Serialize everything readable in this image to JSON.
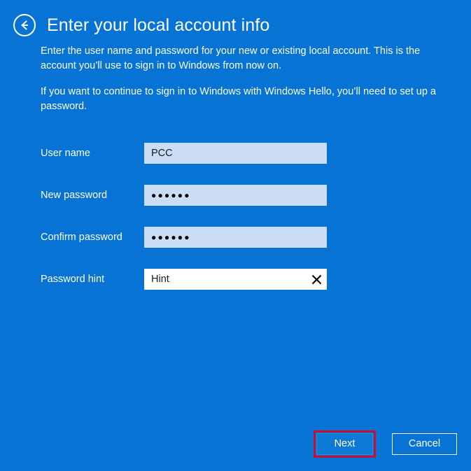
{
  "window": {
    "background_color": "#0673d5"
  },
  "header": {
    "back_icon": "back-arrow-icon",
    "title": "Enter your local account info"
  },
  "description": {
    "paragraph_1": "Enter the user name and password for your new or existing local account. This is the account you’ll use to sign in to Windows from now on.",
    "paragraph_2": "If you want to continue to sign in to Windows with Windows Hello, you’ll need to set up a password."
  },
  "form": {
    "fields": [
      {
        "label": "User name",
        "value": "PCC",
        "placeholder": "",
        "masked": false,
        "focused": false,
        "has_clear": false,
        "background_color": "#cbddf5"
      },
      {
        "label": "New password",
        "value": "●●●●●●",
        "placeholder": "",
        "masked": true,
        "focused": false,
        "has_clear": false,
        "background_color": "#cbddf5"
      },
      {
        "label": "Confirm password",
        "value": "●●●●●●",
        "placeholder": "",
        "masked": true,
        "focused": false,
        "has_clear": false,
        "background_color": "#cbddf5"
      },
      {
        "label": "Password hint",
        "value": "Hint",
        "placeholder": "",
        "masked": false,
        "focused": true,
        "has_clear": true,
        "clear_icon": "clear-x-icon",
        "background_color": "#ffffff"
      }
    ]
  },
  "buttons": {
    "next": {
      "label": "Next",
      "fill_color": "#0d7ad6",
      "highlighted": true,
      "highlight_color": "#c8102e"
    },
    "cancel": {
      "label": "Cancel",
      "border_color": "#ffffff"
    }
  }
}
